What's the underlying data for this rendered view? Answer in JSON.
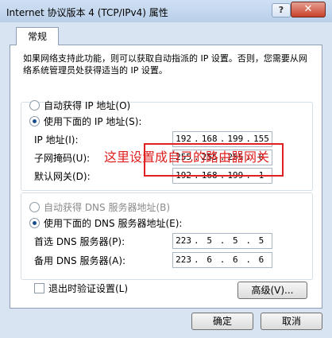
{
  "window": {
    "title": "Internet 协议版本 4 (TCP/IPv4) 属性",
    "help": "?",
    "close": "✕"
  },
  "tab": {
    "label": "常规"
  },
  "description": "如果网络支持此功能，则可以获取自动指派的 IP 设置。否则，您需要从网络系统管理员处获得适当的 IP 设置。",
  "ip": {
    "auto_label": "自动获得 IP 地址(O)",
    "manual_label": "使用下面的 IP 地址(S):",
    "address_label": "IP 地址(I):",
    "subnet_label": "子网掩码(U):",
    "gateway_label": "默认网关(D):",
    "address": [
      "192",
      "168",
      "199",
      "155"
    ],
    "subnet": [
      "255",
      "255",
      "255",
      "0"
    ],
    "gateway": [
      "192",
      "168",
      "199",
      "1"
    ],
    "auto_selected": false,
    "manual_selected": true
  },
  "dns": {
    "auto_label": "自动获得 DNS 服务器地址(B)",
    "manual_label": "使用下面的 DNS 服务器地址(E):",
    "preferred_label": "首选 DNS 服务器(P):",
    "alternate_label": "备用 DNS 服务器(A):",
    "preferred": [
      "223",
      "5",
      "5",
      "5"
    ],
    "alternate": [
      "223",
      "6",
      "6",
      "6"
    ],
    "auto_selected": false,
    "manual_selected": true
  },
  "annotation": {
    "text": "这里设置成自己的路由器网关",
    "color": "#e02020"
  },
  "validate_label": "退出时验证设置(L)",
  "buttons": {
    "advanced": "高级(V)...",
    "ok": "确定",
    "cancel": "取消"
  }
}
